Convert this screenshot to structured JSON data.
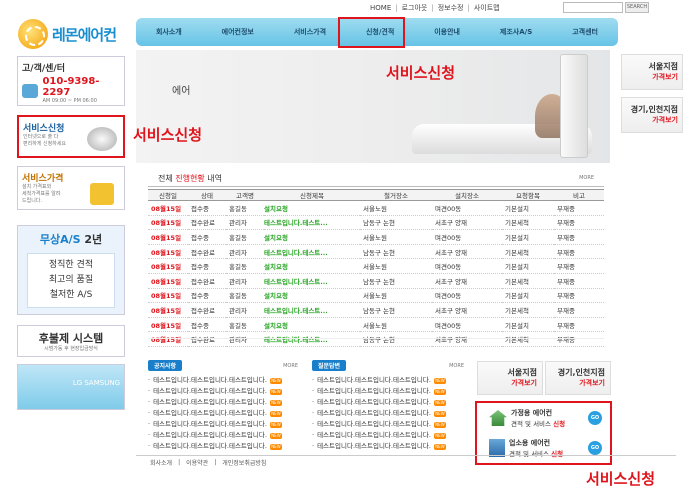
{
  "top_links": {
    "home": "HOME",
    "logout": "로그아웃",
    "profile": "정보수정",
    "sitemap": "사이트맵",
    "search_btn": "SEARCH"
  },
  "logo": {
    "text": "레몬에어컨"
  },
  "nav": {
    "items": [
      "회사소개",
      "에어컨정보",
      "서비스가격",
      "신청/견적",
      "이용안내",
      "제조사A/S",
      "고객센터"
    ]
  },
  "hero": {
    "logo_text": "에어",
    "annotation": "서비스신청"
  },
  "left": {
    "cs_title": "고/객/센/터",
    "cs_phone": "010-9398-2297",
    "cs_hours": "AM 09:00 ~ PM 06:00",
    "svc_apply_title": "서비스신청",
    "svc_apply_desc": "인터넷으로 출 다\n편리하게 신청하세요",
    "svc_apply_annotation": "서비스신청",
    "svc_price_title": "서비스가격",
    "svc_price_desc": "설치 가격표와\n세척가격표를 알려\n드립니다.",
    "as_title": "무상A/S",
    "as_years": "2년",
    "as_lines": [
      "정직한 견적",
      "최고의 품질",
      "철저한 A/S"
    ],
    "postpay_title": "후불제 시스템",
    "postpay_desc": "시범가동 후 현장입금방식",
    "samsung_text": "LG SAMSUNG"
  },
  "right_banners": {
    "seoul_title": "서울지점",
    "seoul_sub": "가격보기",
    "gyeonggi_title": "경기,인천지점",
    "gyeonggi_sub": "가격보기"
  },
  "status": {
    "heading_prefix": "전체",
    "heading_highlight": "진행현황",
    "heading_suffix": "내역",
    "more": "MORE",
    "columns": [
      "신청일",
      "상태",
      "고객명",
      "신청제목",
      "철거장소",
      "설치장소",
      "요청항목",
      "비고"
    ],
    "rows": [
      [
        "08월15일",
        "접수중",
        "홍길동",
        "설치요청",
        "서울노원",
        "며견00동",
        "기본설치",
        "부재중"
      ],
      [
        "08월15일",
        "접수완료",
        "관리자",
        "테스트입니다.테스트...",
        "남동구 논현",
        "서초구 양재",
        "기본세척",
        "부재중"
      ],
      [
        "08월15일",
        "접수중",
        "홍길동",
        "설치요청",
        "서울노원",
        "며견00동",
        "기본설치",
        "부재중"
      ],
      [
        "08월15일",
        "접수완료",
        "관리자",
        "테스트입니다.테스트...",
        "남동구 논현",
        "서초구 양재",
        "기본세척",
        "부재중"
      ],
      [
        "08월15일",
        "접수중",
        "홍길동",
        "설치요청",
        "서울노원",
        "며견00동",
        "기본설치",
        "부재중"
      ],
      [
        "08월15일",
        "접수완료",
        "관리자",
        "테스트입니다.테스트...",
        "남동구 논현",
        "서초구 양재",
        "기본세척",
        "부재중"
      ],
      [
        "08월15일",
        "접수중",
        "홍길동",
        "설치요청",
        "서울노원",
        "며견00동",
        "기본설치",
        "부재중"
      ],
      [
        "08월15일",
        "접수완료",
        "관리자",
        "테스트입니다.테스트...",
        "남동구 논현",
        "서초구 양재",
        "기본세척",
        "부재중"
      ],
      [
        "08월15일",
        "접수중",
        "홍길동",
        "설치요청",
        "서울노원",
        "며견00동",
        "기본설치",
        "부재중"
      ],
      [
        "08월15일",
        "접수완료",
        "관리자",
        "테스트입니다.테스트...",
        "남동구 논현",
        "서초구 양재",
        "기본세척",
        "부재중"
      ]
    ]
  },
  "notice": {
    "tag": "공지사항",
    "more": "MORE",
    "items": [
      "테스트입니다.테스트입니다.테스트입니다.",
      "테스트입니다.테스트입니다.테스트입니다.",
      "테스트입니다.테스트입니다.테스트입니다.",
      "테스트입니다.테스트입니다.테스트입니다.",
      "테스트입니다.테스트입니다.테스트입니다.",
      "테스트입니다.테스트입니다.테스트입니다.",
      "테스트입니다.테스트입니다.테스트입니다."
    ],
    "new_label": "NEW"
  },
  "qna": {
    "tag": "질문답변",
    "more": "MORE",
    "items": [
      "테스트입니다.테스트입니다.테스트입니다.",
      "테스트입니다.테스트입니다.테스트입니다.",
      "테스트입니다.테스트입니다.테스트입니다.",
      "테스트입니다.테스트입니다.테스트입니다.",
      "테스트입니다.테스트입니다.테스트입니다.",
      "테스트입니다.테스트입니다.테스트입니다.",
      "테스트입니다.테스트입니다.테스트입니다."
    ]
  },
  "branch": {
    "seoul_title": "서울지점",
    "seoul_sub": "가격보기",
    "gyeonggi_title": "경기,인천지점",
    "gyeonggi_sub": "가격보기"
  },
  "svc": {
    "home_title": "가정용 에어컨",
    "home_sub_a": "견적 및 서비스",
    "home_sub_b": "신청",
    "biz_title": "업소용 에어컨",
    "biz_sub_a": "견적 및 서비스",
    "biz_sub_b": "신청",
    "go": "GO",
    "annotation": "서비스신청"
  },
  "footer": {
    "links": [
      "회사소개",
      "이용약관",
      "개인정보취급방침"
    ]
  }
}
